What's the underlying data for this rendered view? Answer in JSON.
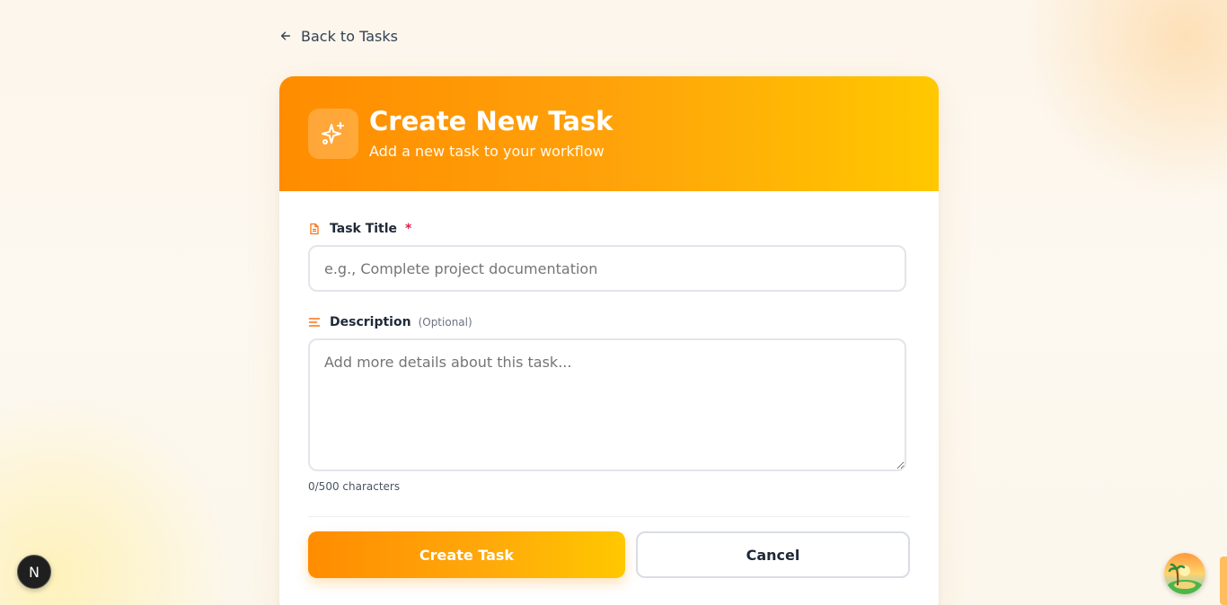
{
  "nav": {
    "back_label": "Back to Tasks"
  },
  "header": {
    "title": "Create New Task",
    "subtitle": "Add a new task to your workflow",
    "icon": "sparkles-icon"
  },
  "form": {
    "title_field": {
      "label": "Task Title",
      "required_marker": "*",
      "placeholder": "e.g., Complete project documentation",
      "value": ""
    },
    "description_field": {
      "label": "Description",
      "optional_hint": "(Optional)",
      "placeholder": "Add more details about this task...",
      "value": ""
    },
    "char_count": "0/500 characters"
  },
  "actions": {
    "submit_label": "Create Task",
    "cancel_label": "Cancel"
  },
  "dev_badge": {
    "letter": "N"
  },
  "colors": {
    "accent_start": "#ff8c00",
    "accent_end": "#ffc800",
    "required": "#e11d48"
  }
}
